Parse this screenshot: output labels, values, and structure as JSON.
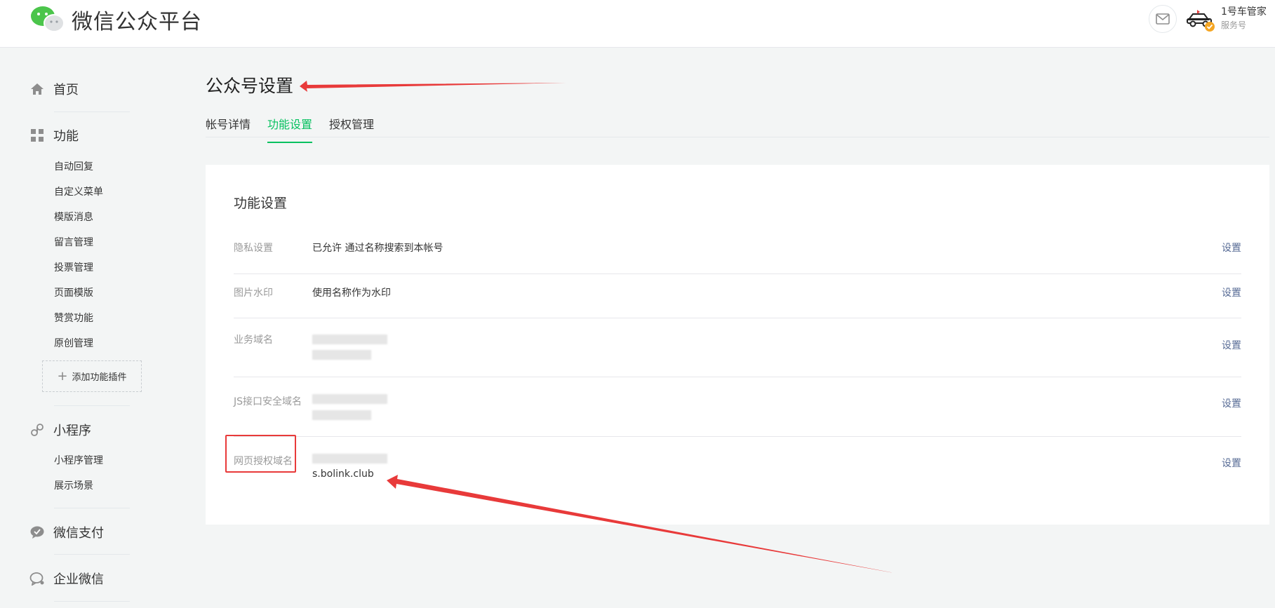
{
  "header": {
    "logo_text": "微信公众平台",
    "account_name": "1号车管家",
    "account_type": "服务号",
    "icons": {
      "logo": "wechat-logo-icon",
      "mail": "mail-icon",
      "avatar": "car-avatar-icon"
    }
  },
  "sidebar": {
    "home": {
      "label": "首页",
      "icon": "home-icon"
    },
    "features": {
      "label": "功能",
      "icon": "grid-icon",
      "items": [
        "自动回复",
        "自定义菜单",
        "模版消息",
        "留言管理",
        "投票管理",
        "页面模版",
        "赞赏功能",
        "原创管理"
      ],
      "add_plugin": "添加功能插件"
    },
    "miniprogram": {
      "label": "小程序",
      "icon": "miniprogram-icon",
      "items": [
        "小程序管理",
        "展示场景"
      ]
    },
    "wechat_pay": {
      "label": "微信支付",
      "icon": "wechat-pay-icon"
    },
    "wework": {
      "label": "企业微信",
      "icon": "wework-icon"
    }
  },
  "main": {
    "title": "公众号设置",
    "tabs": [
      {
        "label": "帐号详情",
        "active": false
      },
      {
        "label": "功能设置",
        "active": true
      },
      {
        "label": "授权管理",
        "active": false
      }
    ],
    "card": {
      "title": "功能设置",
      "rows": [
        {
          "label": "隐私设置",
          "value": "已允许 通过名称搜索到本帐号",
          "action": "设置"
        },
        {
          "label": "图片水印",
          "value": "使用名称作为水印",
          "action": "设置"
        },
        {
          "label": "业务域名",
          "value": "",
          "action": "设置"
        },
        {
          "label": "JS接口安全域名",
          "value": "",
          "action": "设置"
        },
        {
          "label": "网页授权域名",
          "value": "s.bolink.club",
          "action": "设置"
        }
      ]
    }
  },
  "colors": {
    "accent_green": "#07c160",
    "link_blue": "#576b95",
    "annotation_red": "#e83a3a",
    "background": "#f3f5f5"
  }
}
